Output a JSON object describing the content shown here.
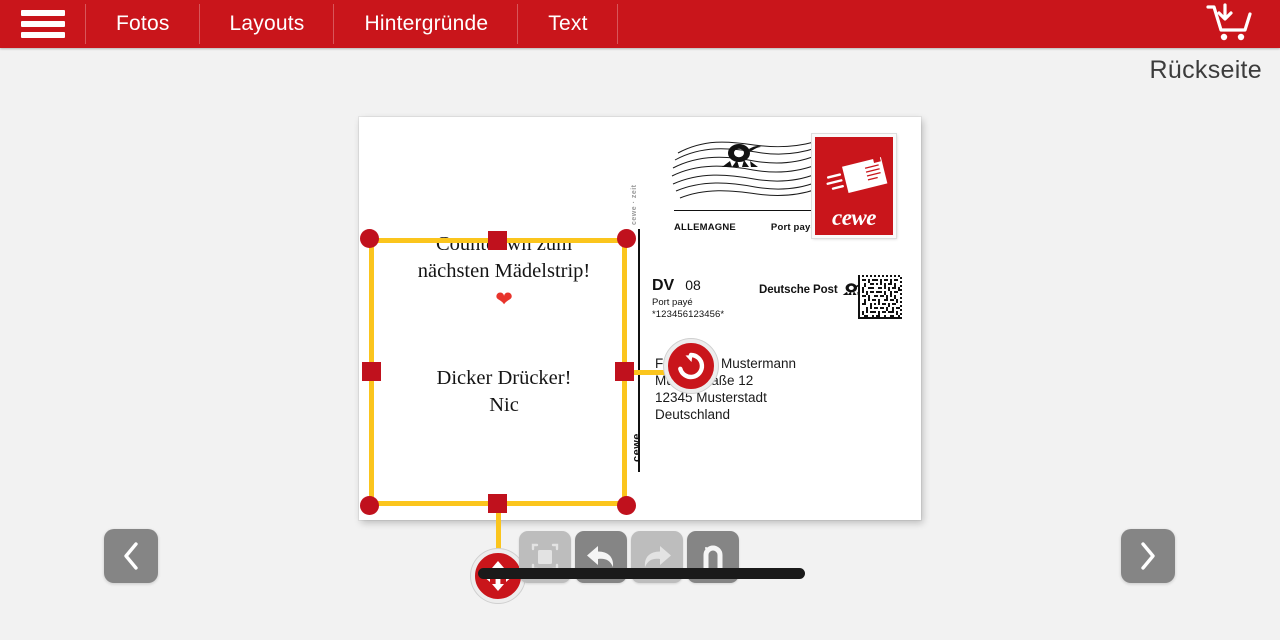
{
  "app": {
    "accent_red": "#c9151b",
    "handle_red": "#c0111d",
    "selection_yellow": "#fbc51d",
    "page_background": "#f2f2f2"
  },
  "topbar": {
    "menu_icon": "hamburger-icon",
    "items": [
      {
        "label": "Fotos"
      },
      {
        "label": "Layouts"
      },
      {
        "label": "Hintergründe"
      },
      {
        "label": "Text"
      }
    ],
    "cart_icon": "cart-download-icon"
  },
  "viewer": {
    "page_label": "Rückseite"
  },
  "postcard": {
    "side": "back",
    "message": {
      "line1": "Countdown zum",
      "line2": "nächsten Mädelstrip!",
      "heart": "❤",
      "signature_line1": "Dicker Drücker!",
      "signature_line2": "Nic"
    },
    "postmark": {
      "icon": "deutsche-post-horn-icon",
      "country": "ALLEMAGNE",
      "franking": "Port payé"
    },
    "stamp": {
      "brand": "cewe",
      "illustration": "flying-postcard-icon",
      "background": "#c9151b"
    },
    "franking_block": {
      "dv_label": "DV",
      "dv_number": "08",
      "port_paye": "Port payé",
      "customer_code": "*123456123456*",
      "carrier": "Deutsche Post",
      "carrier_icon": "deutsche-post-horn-icon",
      "matrix_code": "datamatrix-code"
    },
    "address": {
      "line1": "Frau Erika Mustermann",
      "line2": "Musterstraße 12",
      "line3": "12345 Musterstadt",
      "line4": "Deutschland"
    },
    "divider": {
      "label_top": "cewe · zeit",
      "label_bottom": "cewe"
    }
  },
  "selection": {
    "handles": [
      "top-left",
      "top-center",
      "top-right",
      "middle-left",
      "middle-right",
      "bottom-left",
      "bottom-center",
      "bottom-right"
    ],
    "rotate_handle_icon": "rotate-clockwise-icon",
    "move_handle_icon": "move-four-arrows-icon"
  },
  "toolbar": {
    "buttons": [
      {
        "name": "crop-button",
        "icon": "crop-frame-icon",
        "enabled": false
      },
      {
        "name": "undo-button",
        "icon": "undo-arrow-icon",
        "enabled": true
      },
      {
        "name": "redo-button",
        "icon": "redo-arrow-icon",
        "enabled": false
      },
      {
        "name": "magnet-button",
        "icon": "magnet-icon",
        "enabled": true
      }
    ]
  },
  "pager": {
    "prev_icon": "chevron-left-icon",
    "next_icon": "chevron-right-icon"
  }
}
